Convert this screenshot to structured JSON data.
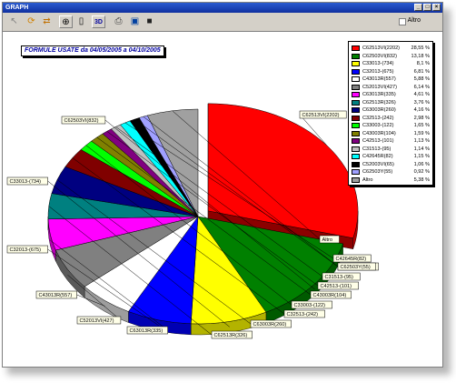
{
  "window": {
    "title": "GRAPH"
  },
  "titlebar_buttons": [
    "_",
    "□",
    "×"
  ],
  "toolbar": {
    "tools": [
      {
        "icon": "cursor-arrow-icon",
        "glyph": "↖"
      },
      {
        "icon": "refresh-icon",
        "glyph": "⟳"
      },
      {
        "icon": "swap-arrows-icon",
        "glyph": "⇄"
      },
      {
        "icon": "zoom-icon",
        "glyph": "⊕"
      },
      {
        "icon": "page-icon",
        "glyph": "▯"
      },
      {
        "icon": "3d-toggle-icon",
        "glyph": "3D"
      },
      {
        "icon": "print-icon",
        "glyph": "⎙"
      },
      {
        "icon": "export-image-icon",
        "glyph": "▣"
      },
      {
        "icon": "save-disk-icon",
        "glyph": "■"
      }
    ],
    "altro_label": "Altro",
    "altro_checked": false
  },
  "chart_title": "FORMULE USATE   da 04/05/2005  a 04/10/2005",
  "chart_data": {
    "type": "pie",
    "title": "FORMULE USATE   da 04/05/2005  a 04/10/2005",
    "legend_position": "top-right",
    "slices": [
      {
        "label": "C62513VI(2202)",
        "pct_text": "28,55 %",
        "value": 28.55,
        "color": "#ff0000",
        "exploded": true
      },
      {
        "label": "C62503VI(832)",
        "pct_text": "13,18 %",
        "value": 13.18,
        "color": "#008000"
      },
      {
        "label": "C33013-(734)",
        "pct_text": "8,1 %",
        "value": 8.1,
        "color": "#ffff00"
      },
      {
        "label": "C32013-(675)",
        "pct_text": "6,81 %",
        "value": 6.81,
        "color": "#0000ff"
      },
      {
        "label": "C43013R(557)",
        "pct_text": "5,88 %",
        "value": 5.88,
        "color": "#ffffff"
      },
      {
        "label": "C52013VI(427)",
        "pct_text": "6,14 %",
        "value": 6.14,
        "color": "#808080"
      },
      {
        "label": "C63013R(335)",
        "pct_text": "4,61 %",
        "value": 4.61,
        "color": "#ff00ff"
      },
      {
        "label": "C62513R(326)",
        "pct_text": "3,76 %",
        "value": 3.76,
        "color": "#008080"
      },
      {
        "label": "C63003R(260)",
        "pct_text": "4,16 %",
        "value": 4.16,
        "color": "#000080"
      },
      {
        "label": "C32513-(242)",
        "pct_text": "2,98 %",
        "value": 2.98,
        "color": "#800000"
      },
      {
        "label": "C33003-(122)",
        "pct_text": "1,65 %",
        "value": 1.65,
        "color": "#00ff00"
      },
      {
        "label": "C43003R(104)",
        "pct_text": "1,59 %",
        "value": 1.59,
        "color": "#808000"
      },
      {
        "label": "C42513-(101)",
        "pct_text": "1,13 %",
        "value": 1.13,
        "color": "#800080"
      },
      {
        "label": "C31513-(95)",
        "pct_text": "1,14 %",
        "value": 1.14,
        "color": "#c0c0c0"
      },
      {
        "label": "C42645R(82)",
        "pct_text": "1,15 %",
        "value": 1.15,
        "color": "#00ffff"
      },
      {
        "label": "C52003VI(65)",
        "pct_text": "1,06 %",
        "value": 1.06,
        "color": "#000000"
      },
      {
        "label": "C62503Y(55)",
        "pct_text": "0,92 %",
        "value": 0.92,
        "color": "#a0a0ff"
      },
      {
        "label": "Altro",
        "pct_text": "5,38 %",
        "value": 5.38,
        "color": "#a0a0a0"
      }
    ]
  }
}
